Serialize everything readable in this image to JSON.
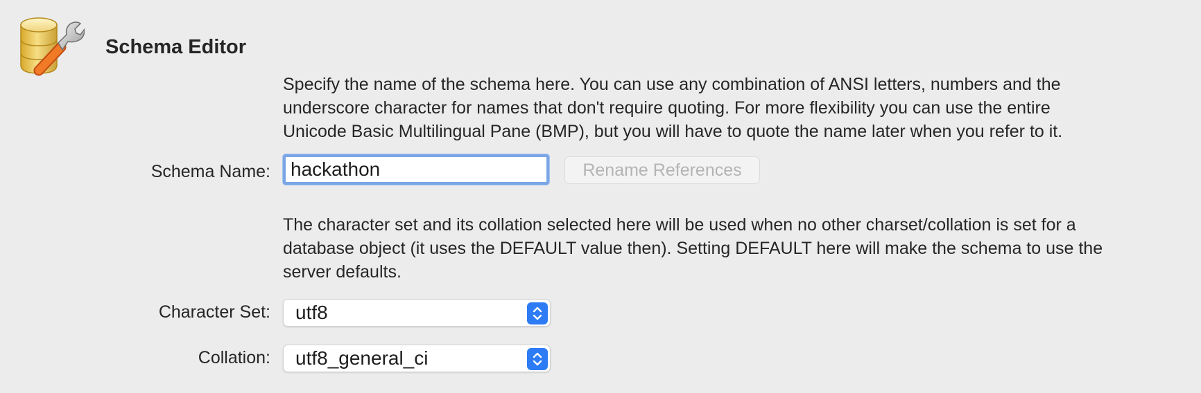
{
  "header": {
    "title": "Schema Editor",
    "icon": "database-wrench-icon"
  },
  "name_section": {
    "description_lines": [
      "Specify the name of the schema here. You can use any combination of ANSI letters, numbers and the",
      "underscore character for names that don't require quoting. For more flexibility you can use the entire",
      "Unicode Basic Multilingual Pane (BMP), but you will have to quote the name later when you refer to it."
    ],
    "label": "Schema Name:",
    "value": "hackathon",
    "rename_button_label": "Rename References"
  },
  "charset_section": {
    "description_lines": [
      "The character set and its collation selected here will be used when no other charset/collation is set for a",
      "database object (it uses the DEFAULT value then). Setting DEFAULT here will make the schema to use the",
      "server defaults."
    ],
    "charset_label": "Character Set:",
    "charset_value": "utf8",
    "collation_label": "Collation:",
    "collation_value": "utf8_general_ci"
  },
  "colors": {
    "background": "#ececec",
    "focus_ring": "#7aa6e6",
    "accent": "#2d7cf6",
    "disabled_text": "#b4b4b4"
  }
}
